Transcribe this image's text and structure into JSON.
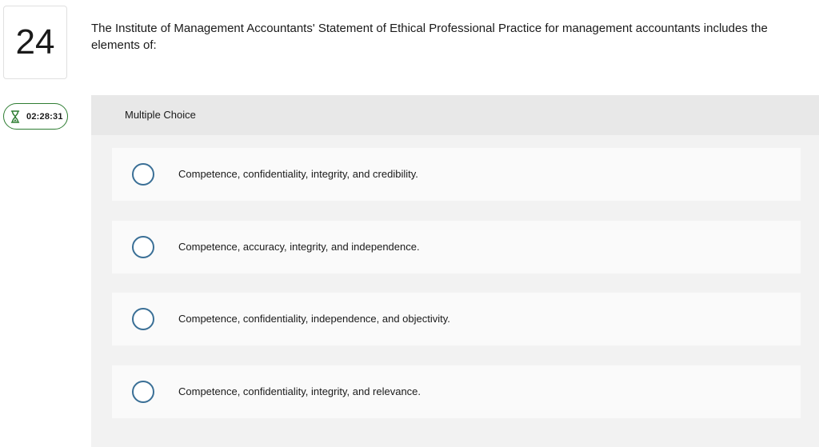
{
  "question": {
    "number": "24",
    "prompt": "The Institute of Management Accountants' Statement of Ethical Professional Practice for management accountants includes the elements of:",
    "type_label": "Multiple Choice"
  },
  "timer": {
    "icon": "hourglass-icon",
    "value": "02:28:31",
    "color": "#2e7d32"
  },
  "choices": [
    {
      "label": "Competence, confidentiality, integrity, and credibility."
    },
    {
      "label": "Competence, accuracy, integrity, and independence."
    },
    {
      "label": "Competence, confidentiality, independence, and objectivity."
    },
    {
      "label": "Competence, confidentiality, integrity, and relevance."
    }
  ],
  "colors": {
    "radio_border": "#3a6f96",
    "panel_background": "#f2f2f2",
    "choice_background": "#fafafa"
  }
}
